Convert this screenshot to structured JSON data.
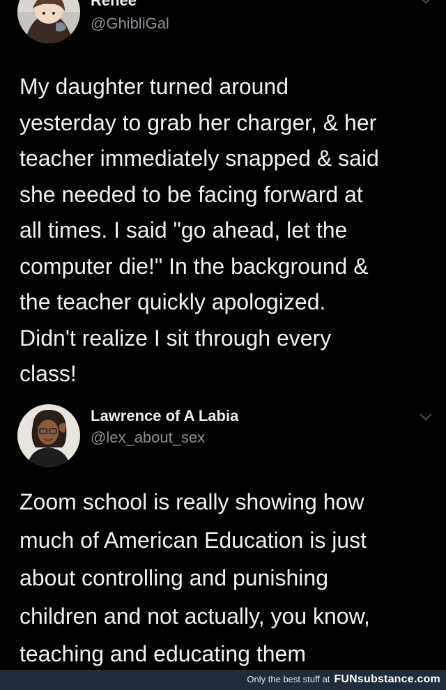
{
  "tweets": [
    {
      "display_name": "Renee",
      "handle": "@GhibliGal",
      "avatar_icon": "anime-character-avatar",
      "text": "My daughter turned around\nyesterday to grab her charger, & her\nteacher immediately snapped & said\nshe needed to be facing forward at\nall times. I said \"go ahead, let the\ncomputer die!\" In the background &\nthe teacher quickly apologized.\nDidn't realize I sit through every\nclass!"
    },
    {
      "display_name": "Lawrence of A Labia",
      "handle": "@lex_about_sex",
      "avatar_icon": "person-photo-avatar",
      "text": "Zoom school is really showing how\nmuch of American Education is just\nabout controlling and punishing\nchildren and not actually, you know,\nteaching and educating them"
    }
  ],
  "footer": {
    "tagline": "Only the best stuff at",
    "brand": "FUNsubstance.com"
  },
  "colors": {
    "background": "#000000",
    "handle": "#8a8f96",
    "footer_bar": "#202c3c"
  }
}
